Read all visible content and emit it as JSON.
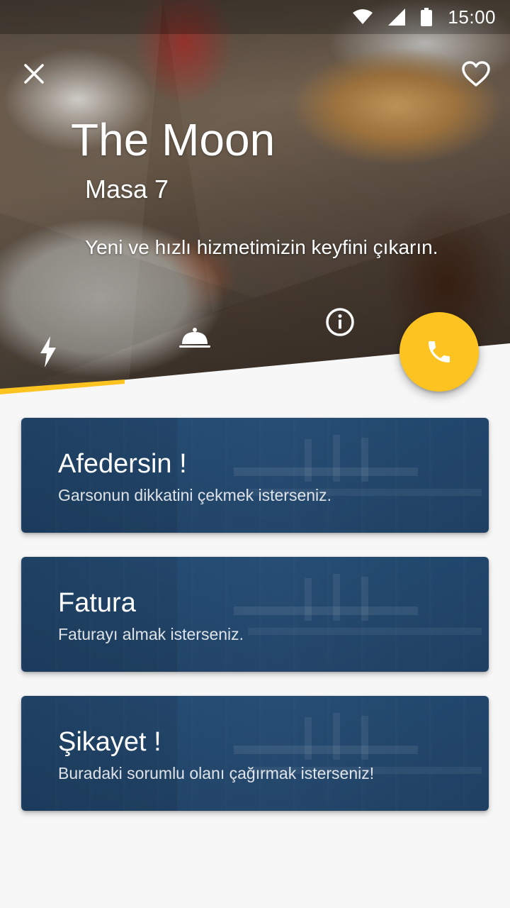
{
  "status_bar": {
    "time": "15:00",
    "icons": [
      "wifi-icon",
      "cell-signal-icon",
      "battery-icon"
    ]
  },
  "header": {
    "close_icon": "close-icon",
    "favorite_icon": "heart-outline-icon",
    "venue_name": "The Moon",
    "table_label": "Masa 7",
    "tagline": "Yeni ve hızlı hizmetimizin keyfini çıkarın."
  },
  "tabs": [
    {
      "icon": "lightning-icon",
      "selected": true
    },
    {
      "icon": "service-bell-icon",
      "selected": false
    },
    {
      "icon": "info-icon",
      "selected": false
    }
  ],
  "fab": {
    "icon": "phone-icon"
  },
  "colors": {
    "accent": "#fdc421",
    "card_bg": "#2f5274",
    "page_bg": "#f7f7f7"
  },
  "cards": [
    {
      "title": "Afedersin !",
      "subtitle": "Garsonun dikkatini çekmek isterseniz."
    },
    {
      "title": "Fatura",
      "subtitle": "Faturayı almak isterseniz."
    },
    {
      "title": "Şikayet !",
      "subtitle": "Buradaki sorumlu olanı çağırmak isterseniz!"
    }
  ]
}
